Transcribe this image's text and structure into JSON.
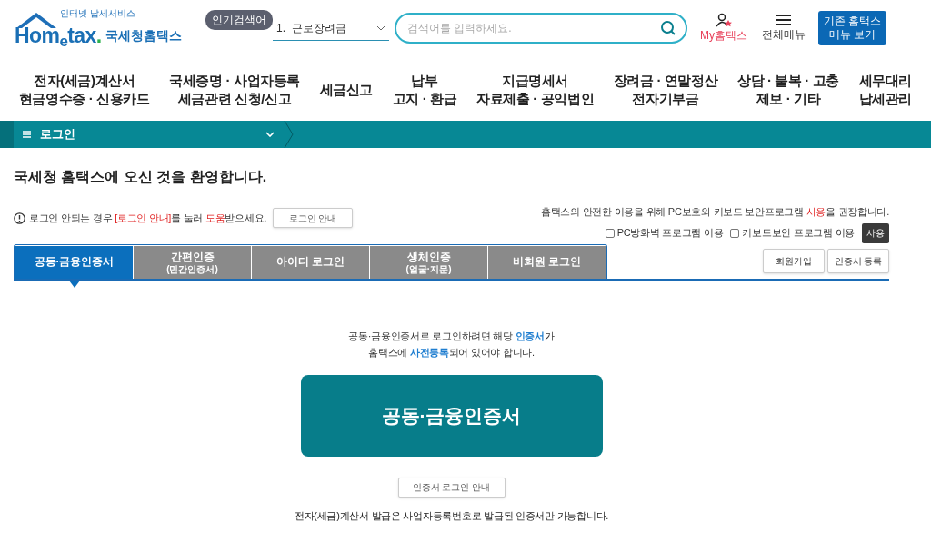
{
  "logo": {
    "tagline": "인터넷 납세서비스",
    "word_parts": [
      "Hom",
      "e",
      "tax",
      "."
    ],
    "name": "국세청홈택스"
  },
  "popular_search": {
    "badge": "인기검색어",
    "value": "1.  근로장려금"
  },
  "search": {
    "placeholder": "검색어를 입력하세요."
  },
  "utility": {
    "my_label": "My홈택스",
    "menu_label": "전체메뉴",
    "legacy_button": [
      "기존 홈택스",
      "메뉴 보기"
    ]
  },
  "nav": [
    [
      "전자(세금)계산서",
      "현금영수증 · 신용카드"
    ],
    [
      "국세증명 · 사업자등록",
      "세금관련 신청/신고"
    ],
    [
      "세금신고"
    ],
    [
      "납부",
      "고지 · 환급"
    ],
    [
      "지급명세서",
      "자료제출 · 공익법인"
    ],
    [
      "장려금 · 연말정산",
      "전자기부금"
    ],
    [
      "상담 · 불복 · 고충",
      "제보 · 기타"
    ],
    [
      "세무대리",
      "납세관리"
    ]
  ],
  "breadcrumb": {
    "label": "로그인"
  },
  "welcome": "국세청 홈택스에 오신 것을 환영합니다.",
  "notice": [
    {
      "text": "로그인 안되는 경우 ",
      "highlight": false
    },
    {
      "text": "[로그인 안내]",
      "highlight": true
    },
    {
      "text": "를 눌러 ",
      "highlight": false
    },
    {
      "text": "도움",
      "highlight": true
    },
    {
      "text": "받으세요.",
      "highlight": false
    }
  ],
  "notice_button": "로그인 안내",
  "security_notice": [
    {
      "text": "홈택스의 안전한 이용을 위해 PC보호와 키보드 보안프로그램 ",
      "highlight": false
    },
    {
      "text": "사용",
      "highlight": true
    },
    {
      "text": "을 권장합니다.",
      "highlight": false
    }
  ],
  "security_options": [
    {
      "label": "PC방화벽 프로그램 이용",
      "checked": false
    },
    {
      "label": "키보드보안 프로그램 이용",
      "checked": false
    }
  ],
  "security_button": "사용",
  "tabs": [
    {
      "label": "공동·금융인증서",
      "selected": true
    },
    {
      "label": "간편인증",
      "sub": "(민간인증서)",
      "selected": false
    },
    {
      "label": "아이디 로그인",
      "selected": false
    },
    {
      "label": "생체인증",
      "sub": "(얼굴·지문)",
      "selected": false
    },
    {
      "label": "비회원 로그인",
      "selected": false
    }
  ],
  "side_buttons": [
    "회원가입",
    "인증서 등록"
  ],
  "description": [
    [
      {
        "text": "공동·금융인증서로 로그인하려면 해당 ",
        "highlight": false
      },
      {
        "text": "인증서",
        "highlight": true
      },
      {
        "text": "가",
        "highlight": false
      }
    ],
    [
      {
        "text": "홈택스에 ",
        "highlight": false
      },
      {
        "text": "사전등록",
        "highlight": true
      },
      {
        "text": "되어 있어야 합니다.",
        "highlight": false
      }
    ]
  ],
  "login_button": "공동·금융인증서",
  "guide_button": "인증서 로그인 안내",
  "footnote": "전자(세금)계산서 발급은 사업자등록번호로 발급된 인증서만 가능합니다."
}
